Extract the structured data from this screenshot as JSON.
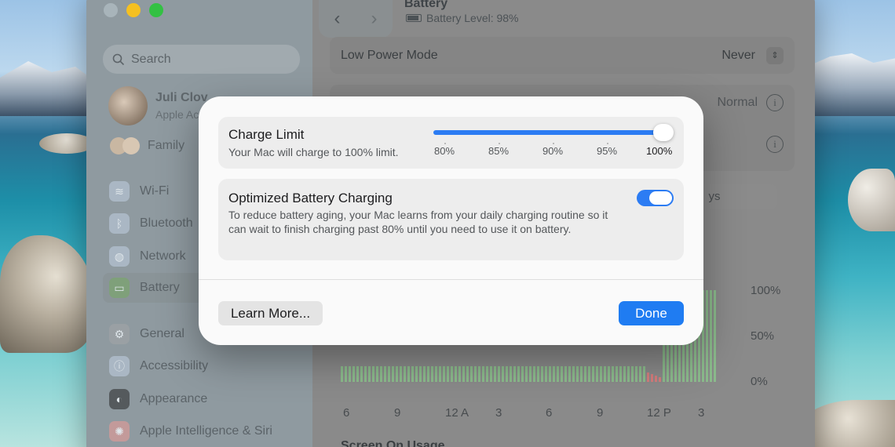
{
  "window": {
    "title": "Battery",
    "battery_level": "Battery Level: 98%"
  },
  "sidebar": {
    "search_placeholder": "Search",
    "profile_name": "Juli Clov",
    "profile_sub": "Apple Ac",
    "family": "Family",
    "items": [
      {
        "label": "Wi-Fi",
        "icon": "wifi-icon",
        "color": "#aab7c4"
      },
      {
        "label": "Bluetooth",
        "icon": "bluetooth-icon",
        "color": "#aab7c4"
      },
      {
        "label": "Network",
        "icon": "globe-icon",
        "color": "#aab7c4"
      },
      {
        "label": "Battery",
        "icon": "battery-icon",
        "color": "#7fa07a"
      },
      {
        "label": "General",
        "icon": "gear-icon",
        "color": "#9aa0a4"
      },
      {
        "label": "Accessibility",
        "icon": "accessibility-icon",
        "color": "#aab7c4"
      },
      {
        "label": "Appearance",
        "icon": "appearance-icon",
        "color": "#555a5d"
      },
      {
        "label": "Apple Intelligence & Siri",
        "icon": "siri-icon",
        "color": "#c39a9a"
      }
    ]
  },
  "content": {
    "low_power_mode_label": "Low Power Mode",
    "low_power_mode_value": "Never",
    "energy_mode_value": "Normal",
    "segment_fragment": "ys",
    "chart_y_labels": [
      "100%",
      "50%",
      "0%"
    ],
    "chart_x_labels": [
      "6",
      "9",
      "12 A",
      "3",
      "6",
      "9",
      "12 P",
      "3"
    ],
    "screen_on_usage": "Screen On Usage"
  },
  "dialog": {
    "charge_limit_title": "Charge Limit",
    "charge_limit_sub": "Your Mac will charge to 100% limit.",
    "slider_ticks": [
      "80%",
      "85%",
      "90%",
      "95%",
      "100%"
    ],
    "slider_value": "100%",
    "optimized_title": "Optimized Battery Charging",
    "optimized_sub": "To reduce battery aging, your Mac learns from your daily charging routine so it can wait to finish charging past 80% until you need to use it on battery.",
    "optimized_enabled": true,
    "learn_more": "Learn More...",
    "done": "Done"
  },
  "colors": {
    "accent": "#1f7cf2",
    "chart_green": "#8cc48d",
    "chart_red": "#e07a7a"
  }
}
